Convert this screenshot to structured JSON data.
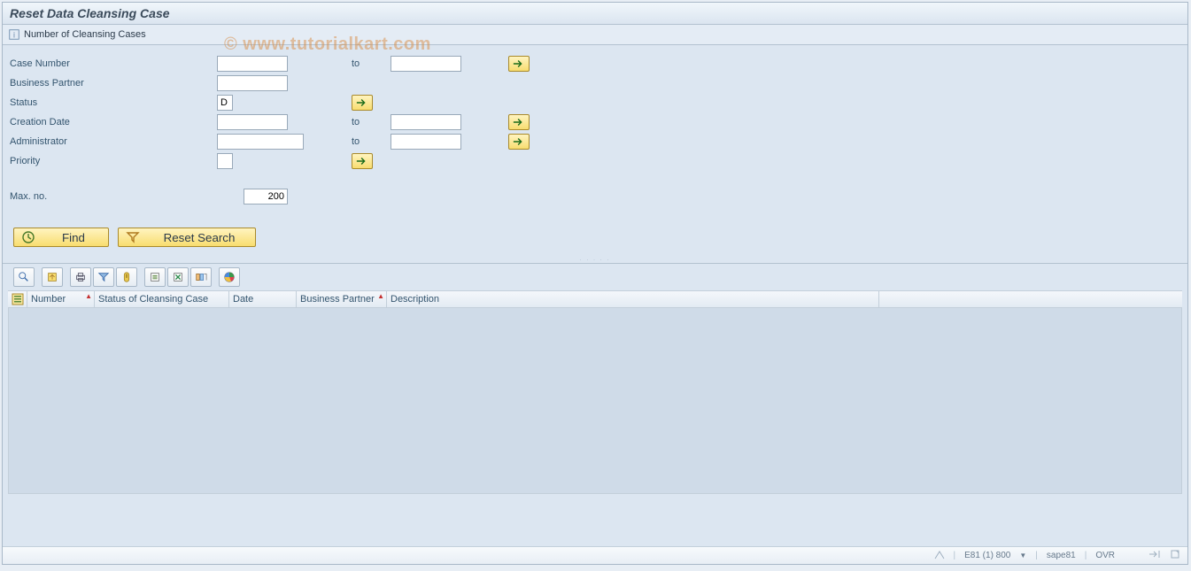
{
  "header": {
    "title": "Reset Data Cleansing Case"
  },
  "app_toolbar": {
    "cases_count_label": "Number of Cleansing Cases"
  },
  "watermark": "© www.tutorialkart.com",
  "form": {
    "case_number": {
      "label": "Case Number",
      "from": "",
      "to_label": "to",
      "to": ""
    },
    "business_partner": {
      "label": "Business Partner",
      "value": ""
    },
    "status": {
      "label": "Status",
      "value": "D"
    },
    "creation_date": {
      "label": "Creation Date",
      "from": "",
      "to_label": "to",
      "to": ""
    },
    "administrator": {
      "label": "Administrator",
      "from": "",
      "to_label": "to",
      "to": ""
    },
    "priority": {
      "label": "Priority",
      "value": ""
    },
    "max_no": {
      "label": "Max. no.",
      "value": "200"
    }
  },
  "buttons": {
    "find": "Find",
    "reset_search": "Reset Search"
  },
  "alv": {
    "columns": {
      "number": "Number",
      "status": "Status of Cleansing Case",
      "date": "Date",
      "bp": "Business Partner",
      "desc": "Description"
    }
  },
  "status": {
    "sys": "E81 (1) 800",
    "server": "sape81",
    "mode": "OVR"
  }
}
